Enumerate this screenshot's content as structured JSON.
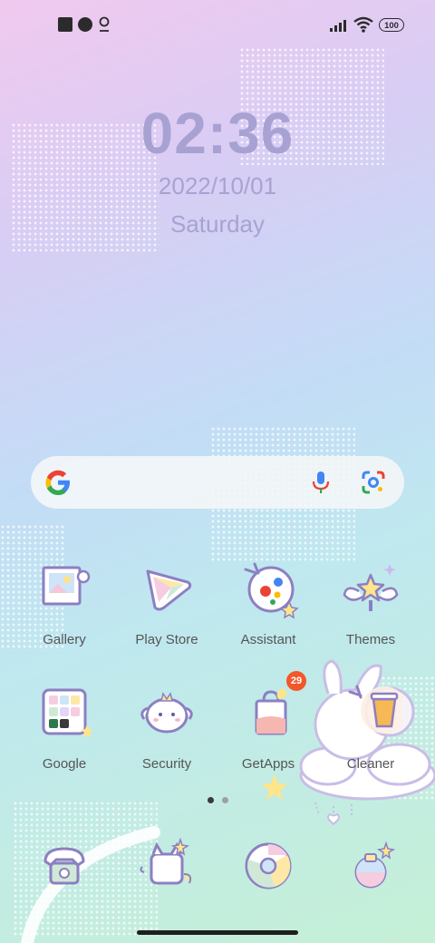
{
  "status_bar": {
    "battery": "100",
    "icons": [
      "notification-square-icon",
      "app-notification-icon",
      "location-pin-icon",
      "signal-icon",
      "wifi-icon",
      "battery-icon"
    ]
  },
  "lock": {
    "time": "02:36",
    "date": "2022/10/01",
    "day": "Saturday"
  },
  "search": {
    "icons": [
      "google-g-icon",
      "microphone-icon",
      "lens-camera-icon"
    ]
  },
  "apps_row1": [
    {
      "label": "Gallery",
      "icon": "gallery-icon"
    },
    {
      "label": "Play Store",
      "icon": "play-store-icon"
    },
    {
      "label": "Assistant",
      "icon": "assistant-icon"
    },
    {
      "label": "Themes",
      "icon": "themes-icon"
    }
  ],
  "apps_row2": [
    {
      "label": "Google",
      "icon": "google-folder-icon"
    },
    {
      "label": "Security",
      "icon": "security-icon"
    },
    {
      "label": "GetApps",
      "icon": "getapps-icon"
    },
    {
      "label": "Cleaner",
      "icon": "cleaner-icon"
    }
  ],
  "getapps_badge": "29",
  "dock": [
    {
      "icon": "phone-icon"
    },
    {
      "icon": "messages-icon"
    },
    {
      "icon": "chrome-icon"
    },
    {
      "icon": "camera-icon"
    }
  ],
  "page_indicator": {
    "count": 2,
    "active": 1
  },
  "colors": {
    "clock": "#a8a2d3",
    "badge": "#f2572b",
    "outline": "#8d7fc2"
  }
}
